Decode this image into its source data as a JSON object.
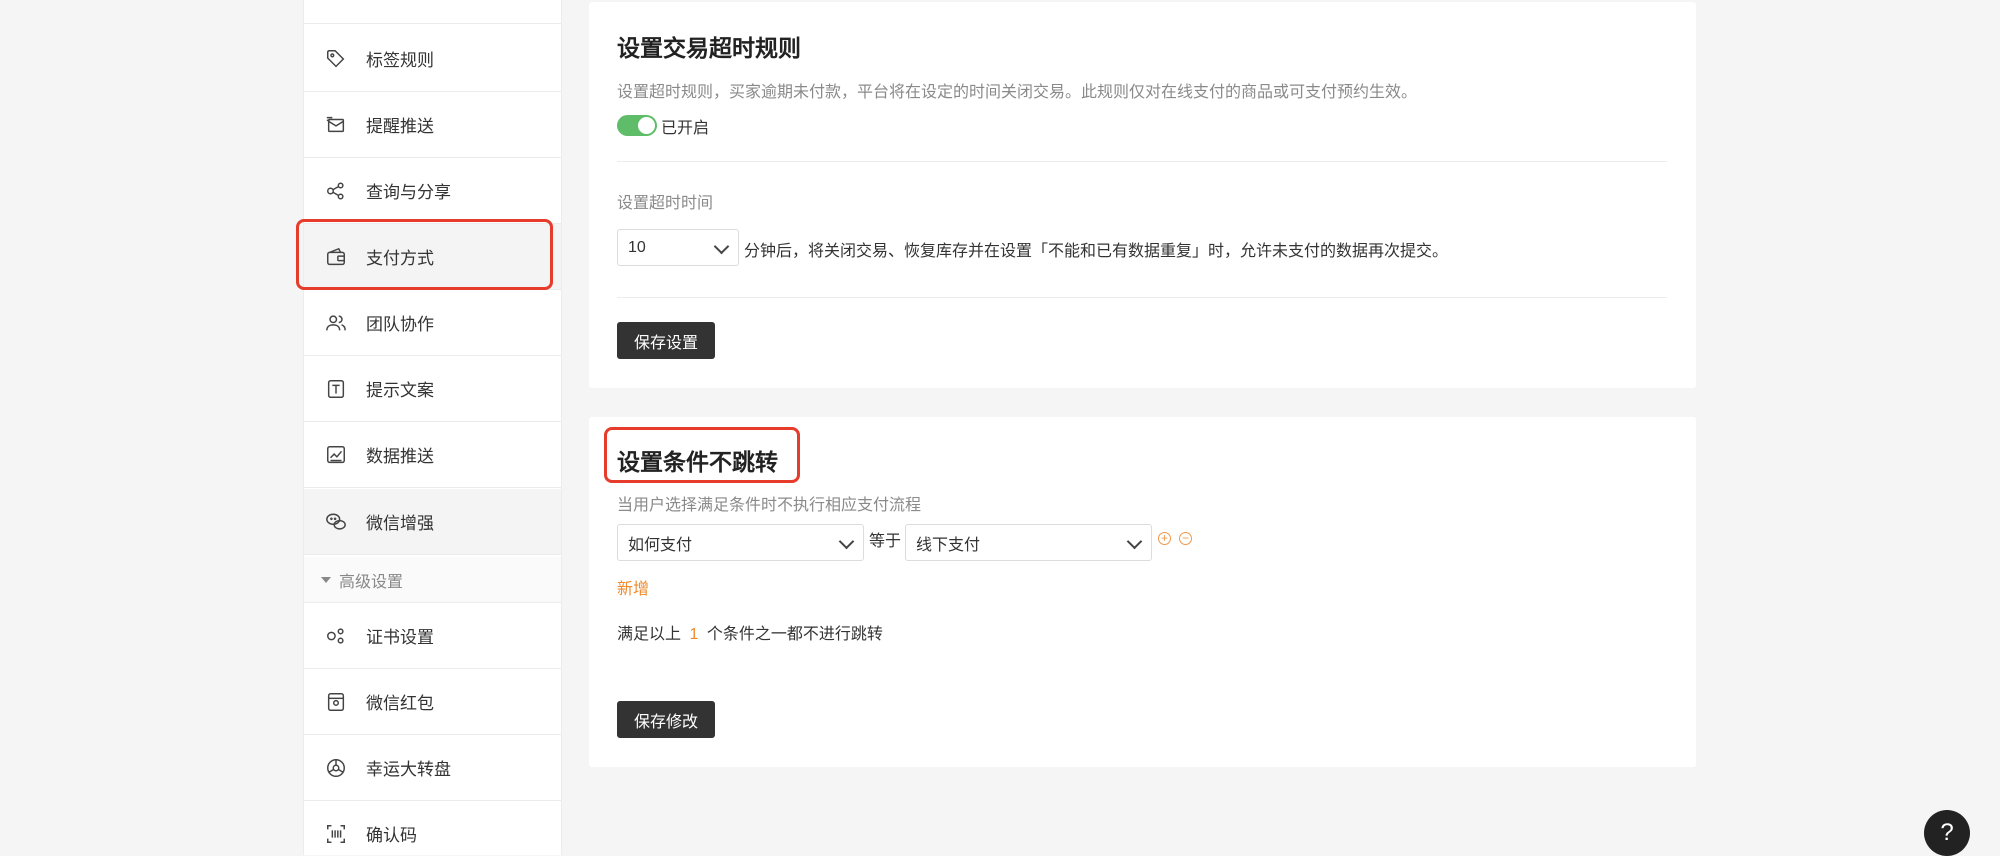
{
  "sidebar": {
    "items": [
      {
        "label": "标签规则",
        "icon": "tag-icon"
      },
      {
        "label": "提醒推送",
        "icon": "mail-icon"
      },
      {
        "label": "查询与分享",
        "icon": "share-icon"
      },
      {
        "label": "支付方式",
        "icon": "wallet-icon"
      },
      {
        "label": "团队协作",
        "icon": "team-icon"
      },
      {
        "label": "提示文案",
        "icon": "text-icon"
      },
      {
        "label": "数据推送",
        "icon": "chart-icon"
      },
      {
        "label": "微信增强",
        "icon": "wechat-icon"
      }
    ],
    "group_label": "高级设置",
    "advanced_items": [
      {
        "label": "证书设置",
        "icon": "certificate-icon"
      },
      {
        "label": "微信红包",
        "icon": "red-packet-icon"
      },
      {
        "label": "幸运大转盘",
        "icon": "wheel-icon"
      },
      {
        "label": "确认码",
        "icon": "scan-code-icon"
      }
    ]
  },
  "timeout_card": {
    "title": "设置交易超时规则",
    "description": "设置超时规则，买家逾期未付款，平台将在设定的时间关闭交易。此规则仅对在线支付的商品或可支付预约生效。",
    "toggle_label": "已开启",
    "toggle_on": true,
    "time_label": "设置超时时间",
    "time_value": "10",
    "time_suffix": "分钟后，将关闭交易、恢复库存并在设置「不能和已有数据重复」时，允许未支付的数据再次提交。",
    "save_button": "保存设置"
  },
  "condition_card": {
    "title": "设置条件不跳转",
    "description": "当用户选择满足条件时不执行相应支付流程",
    "field_select": "如何支付",
    "operator": "等于",
    "value_select": "线下支付",
    "add_link": "新增",
    "summary_prefix": "满足以上",
    "summary_count": "1",
    "summary_suffix": "个条件之一都不进行跳转",
    "save_button": "保存修改"
  },
  "help_button": "?",
  "colors": {
    "accent_orange": "#f08a2c",
    "toggle_green": "#5fbd6a",
    "highlight_red": "#e53c2c",
    "button_dark": "#333333"
  }
}
